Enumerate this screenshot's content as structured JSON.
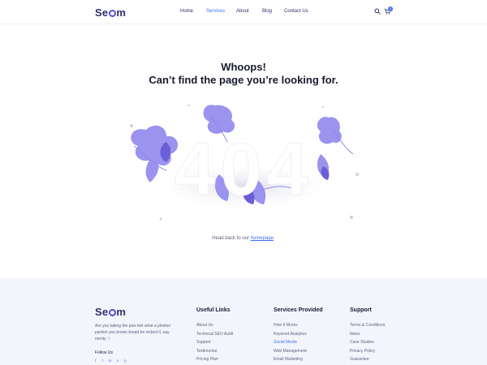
{
  "brand": {
    "logo_pre": "Se",
    "logo_post": "m"
  },
  "nav": [
    {
      "label": "Home"
    },
    {
      "label": "Services",
      "active": true
    },
    {
      "label": "About"
    },
    {
      "label": "Blog"
    },
    {
      "label": "Contact Us"
    }
  ],
  "cart": {
    "count": "0"
  },
  "icons": {
    "search": "search-icon",
    "cart": "cart-icon"
  },
  "error": {
    "line1": "Whoops!",
    "line2": "Can’t find the page you’re looking for.",
    "code": "404",
    "back_prefix": "Head back to our",
    "back_link": "homepage",
    "back_suffix": "."
  },
  "footer": {
    "about": "Are you taking the piss twit what a plonker pardon you brown bread he nicked it, say monty .!",
    "follow_label": "Follow Us",
    "socials": [
      "f",
      "t",
      "in",
      "v",
      "p"
    ],
    "columns": [
      {
        "title": "Useful Links",
        "items": [
          "About Us",
          "Technical SEO Audit",
          "Support",
          "Testimonial",
          "Pricing Plan"
        ]
      },
      {
        "title": "Services Provided",
        "items": [
          "How It Works",
          "Keyword Analytics",
          "Social Media",
          "Web Management",
          "Email Marketing"
        ]
      },
      {
        "title": "Support",
        "items": [
          "Terms & Conditions",
          "News",
          "Case Studies",
          "Privacy Policy",
          "Guarantee"
        ]
      }
    ]
  },
  "colors": {
    "accent": "#3f6df0",
    "brand": "#2d2f6b",
    "leaf": "#9b93ee",
    "leaf_dark": "#6a5fd8",
    "footer_bg": "#f3f5fd"
  }
}
